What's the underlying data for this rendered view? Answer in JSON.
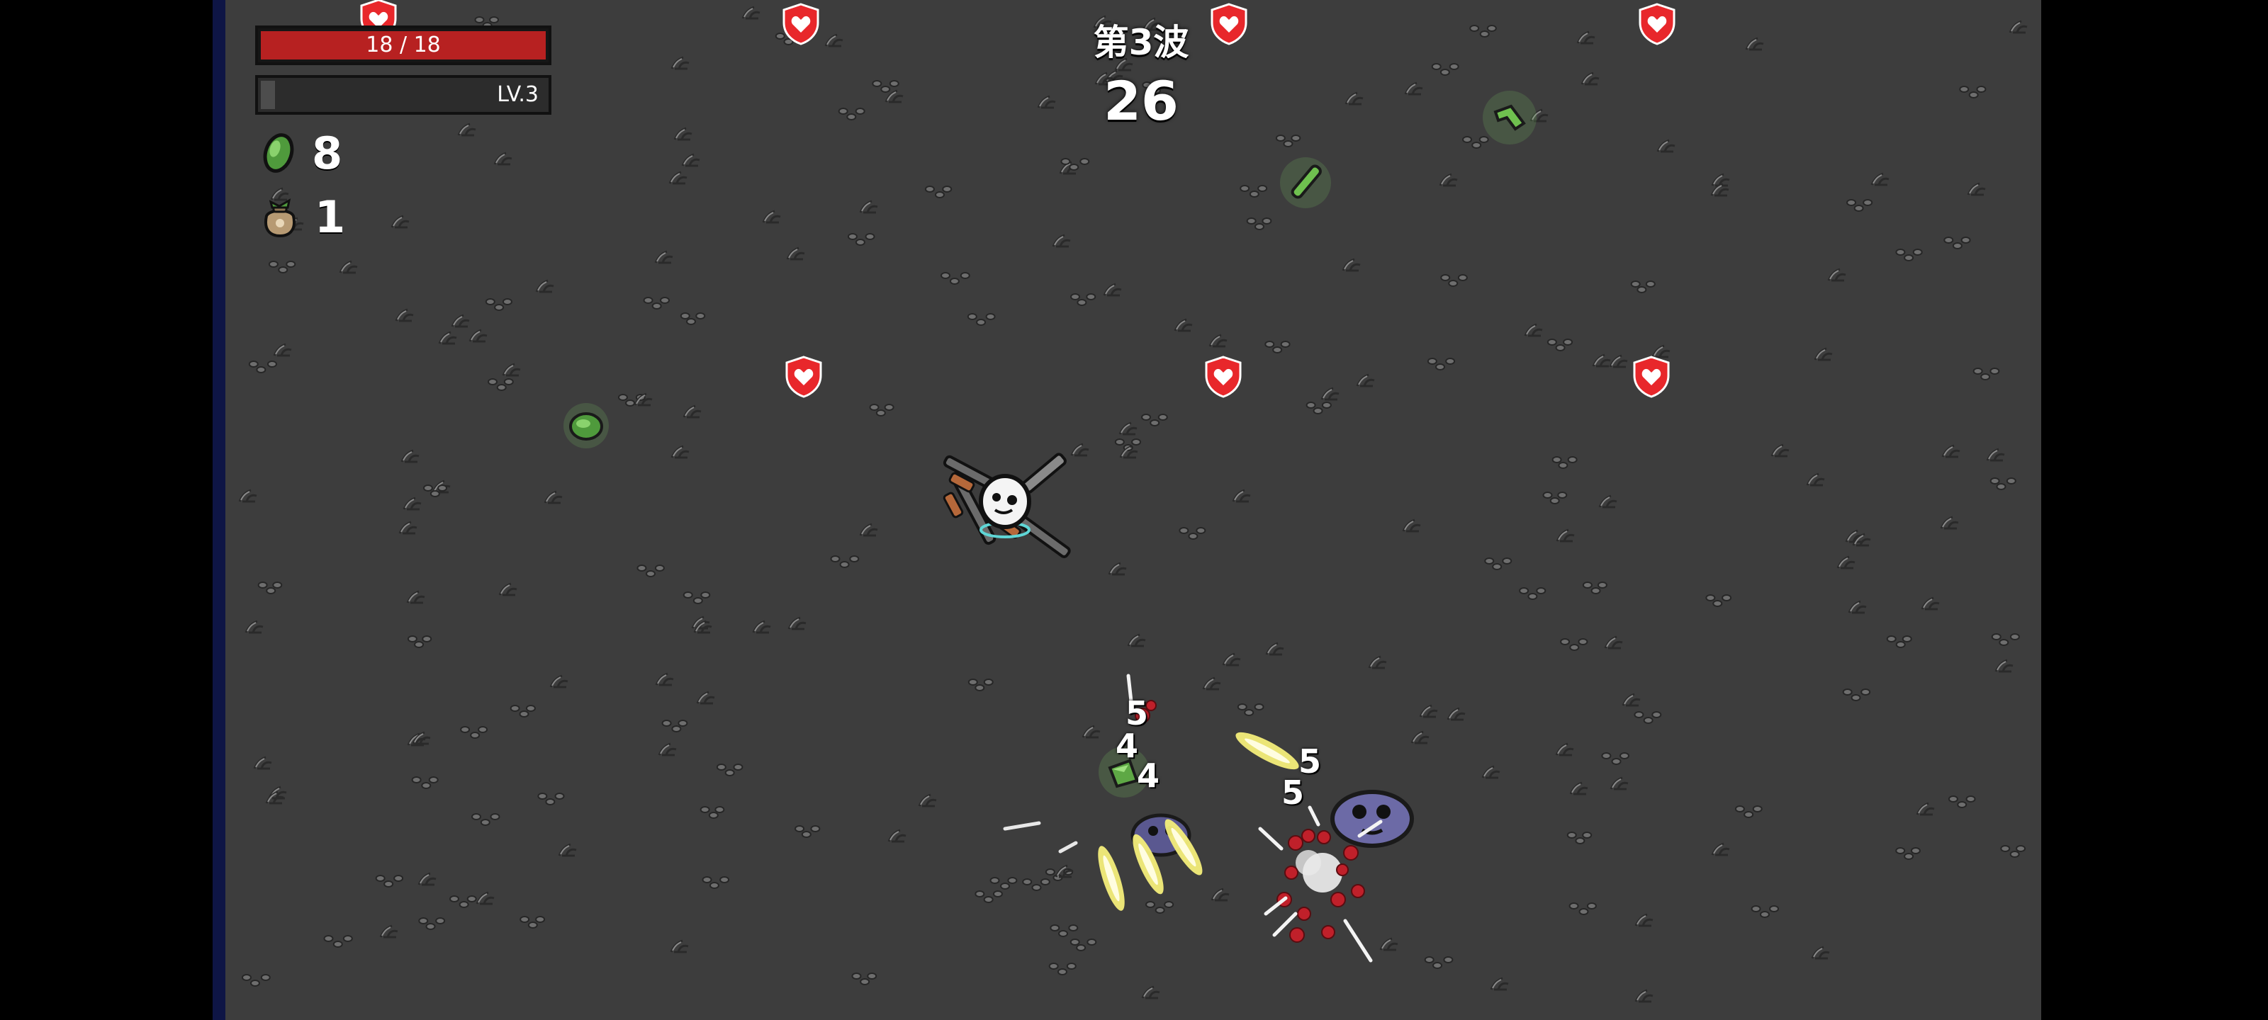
{
  "hud": {
    "hp": {
      "current": 18,
      "max": 18,
      "text": "18 / 18",
      "ratio": 1.0,
      "color": "#b72121"
    },
    "level": {
      "text": "LV.3",
      "xp_ratio": 0.05
    },
    "materials": {
      "icon": "material-icon",
      "count": "8"
    },
    "bags": {
      "icon": "loot-bag-icon",
      "count": "1"
    }
  },
  "wave": {
    "title": "第3波",
    "timer": "26"
  },
  "damage_numbers": [
    "5",
    "4",
    "4",
    "5",
    "5"
  ],
  "colors": {
    "arena": "#3d3d3d",
    "outer": "#000000",
    "edge": "#1d2a6b",
    "spawn_marker": "#e8272b",
    "material": "#7bc862",
    "projectile": "#f4ee7a"
  },
  "entities": {
    "player": "potato-player",
    "weapons": "shotgun-weapon",
    "enemies": "alien-enemy",
    "spawn_markers": "spawn-indicator-icon",
    "drops": "material-drop"
  }
}
